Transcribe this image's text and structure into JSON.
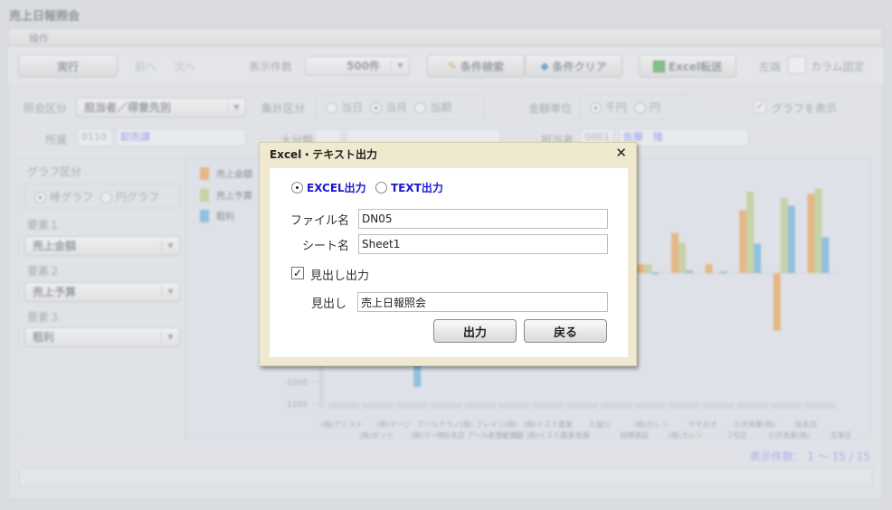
{
  "app": {
    "title": "売上日報照会"
  },
  "menu": {
    "operations": "操作"
  },
  "toolbar": {
    "run": "実行",
    "prev": "前へ",
    "next": "次へ",
    "display_count_label": "表示件数",
    "display_count_value": "500件",
    "condition_search": "条件検索",
    "condition_clear": "条件クリア",
    "excel_export": "Excel転送",
    "left_edge_label": "左端",
    "column_fix_label": "カラム固定"
  },
  "filters": {
    "inquiry_type_label": "照会区分",
    "inquiry_type_value": "担当者／得意先別",
    "aggregate_label": "集計区分",
    "aggregate_options": [
      "当日",
      "当月",
      "当期"
    ],
    "aggregate_selected": "当月",
    "amount_unit_label": "金額単位",
    "amount_unit_options": [
      "千円",
      "円"
    ],
    "amount_unit_selected": "千円",
    "show_graph_label": "グラフを表示",
    "show_graph_checked": true,
    "dept_label": "所属",
    "dept_code": "0110",
    "dept_name": "卸売課",
    "major_class_label": "大分類",
    "major_class_code": "",
    "major_class_name": "",
    "person_label": "担当者",
    "person_code": "0001",
    "person_name": "佐藤　隆"
  },
  "graph_settings": {
    "type_label": "グラフ区分",
    "type_options": [
      "棒グラフ",
      "円グラフ"
    ],
    "type_selected": "棒グラフ",
    "element1_label": "要素１",
    "element1_value": "売上金額",
    "element2_label": "要素２",
    "element2_value": "売上予算",
    "element3_label": "要素３",
    "element3_value": "粗利"
  },
  "chart_data": {
    "type": "bar",
    "title": "",
    "xlabel": "",
    "ylabel": "",
    "legend_position": "top-left",
    "ylim": [
      -1200,
      1000
    ],
    "visible_y_ticks": [
      -1000,
      -1200
    ],
    "categories": [
      "(株)アシスト",
      "(株)ゼンド",
      "(株)マージ",
      "(株)マージ",
      "アールテラノ(株)",
      "渋谷支店 アールテラノ(株)",
      "ブレイン(株)",
      "名古屋支店 (株)イズミ農業",
      "(株)イズミ農業",
      "久留川 佐藤",
      "尚輝建設",
      "(株)カレン",
      "(株)カレン",
      "やそおき 2号店",
      "小沢漁業(株)",
      "小沢漁業(株)",
      "街永店 浩澤店"
    ],
    "series": [
      {
        "name": "売上金額",
        "color": "#e8ad6a",
        "values": [
          0,
          0,
          0,
          0,
          0,
          0,
          0,
          0,
          0,
          80,
          370,
          80,
          580,
          -530,
          730
        ]
      },
      {
        "name": "売上予算",
        "color": "#c3cf94",
        "values": [
          0,
          0,
          0,
          0,
          0,
          0,
          0,
          0,
          0,
          80,
          280,
          0,
          750,
          690,
          780
        ]
      },
      {
        "name": "粗利",
        "color": "#7ab8e0",
        "values": [
          0,
          0,
          -1050,
          0,
          0,
          0,
          0,
          0,
          0,
          5,
          25,
          15,
          270,
          620,
          330
        ]
      }
    ]
  },
  "x_axis_labels_row1": [
    "(株)アシスト",
    "(株)マージ",
    "アールテラノ(株)",
    "ブレイン(株)",
    "(株)イズミ農業",
    "久留川",
    "(株)カレン",
    "やそおき",
    "小沢漁業(株)",
    "街永店"
  ],
  "x_axis_labels_row2": [
    "(株)ゼンド",
    "(株)マージ",
    "渋谷支店 アールテラノ(株)",
    "名古屋支店 (株)イズミ農業",
    "佐藤",
    "尚輝建設",
    "(株)カレン",
    "2号店",
    "小沢漁業(株)",
    "浩澤店"
  ],
  "pagination": {
    "display_count": "表示件数： 1 ～ 15 / 15"
  },
  "dialog": {
    "title": "Excel・テキスト出力",
    "close": "✕",
    "output_options": [
      "EXCEL出力",
      "TEXT出力"
    ],
    "output_selected": "EXCEL出力",
    "file_name_label": "ファイル名",
    "file_name_value": "DN05",
    "sheet_name_label": "シート名",
    "sheet_name_value": "Sheet1",
    "heading_output_label": "見出し出力",
    "heading_output_checked": true,
    "heading_label": "見出し",
    "heading_value": "売上日報照会",
    "output_button": "出力",
    "back_button": "戻る"
  }
}
